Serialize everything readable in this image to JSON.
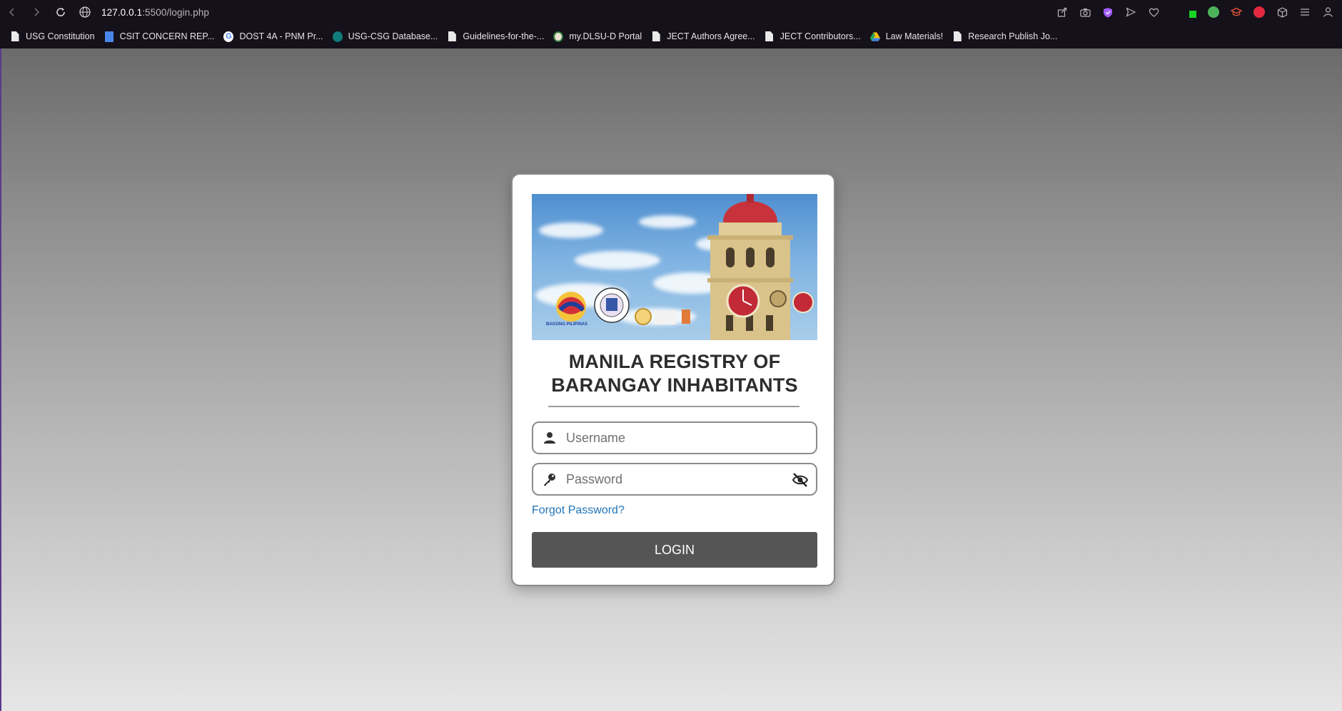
{
  "browser": {
    "url_host": "127.0.0.1",
    "url_rest": ":5500/login.php",
    "bookmarks": [
      {
        "label": "USG Constitution",
        "icon": "doc-icon"
      },
      {
        "label": "CSIT CONCERN REP...",
        "icon": "google-docs-icon"
      },
      {
        "label": "DOST 4A - PNM Pr...",
        "icon": "google-icon"
      },
      {
        "label": "USG-CSG Database...",
        "icon": "sharepoint-icon"
      },
      {
        "label": "Guidelines-for-the-...",
        "icon": "doc-icon"
      },
      {
        "label": "my.DLSU-D Portal",
        "icon": "dlsu-icon"
      },
      {
        "label": "JECT Authors Agree...",
        "icon": "doc-icon"
      },
      {
        "label": "JECT Contributors...",
        "icon": "doc-icon"
      },
      {
        "label": "Law Materials!",
        "icon": "google-drive-icon"
      },
      {
        "label": "Research Publish Jo...",
        "icon": "doc-icon"
      }
    ]
  },
  "login": {
    "title_line1": "MANILA REGISTRY OF",
    "title_line2": "BARANGAY INHABITANTS",
    "username_placeholder": "Username",
    "password_placeholder": "Password",
    "forgot_label": "Forgot Password?",
    "login_label": "LOGIN",
    "banner_logo_text": "BAGONG PILIPINAS"
  },
  "colors": {
    "button": "#555555",
    "link": "#1f73b7",
    "tower_dome": "#c8323a",
    "tower_body": "#d9c38a"
  }
}
